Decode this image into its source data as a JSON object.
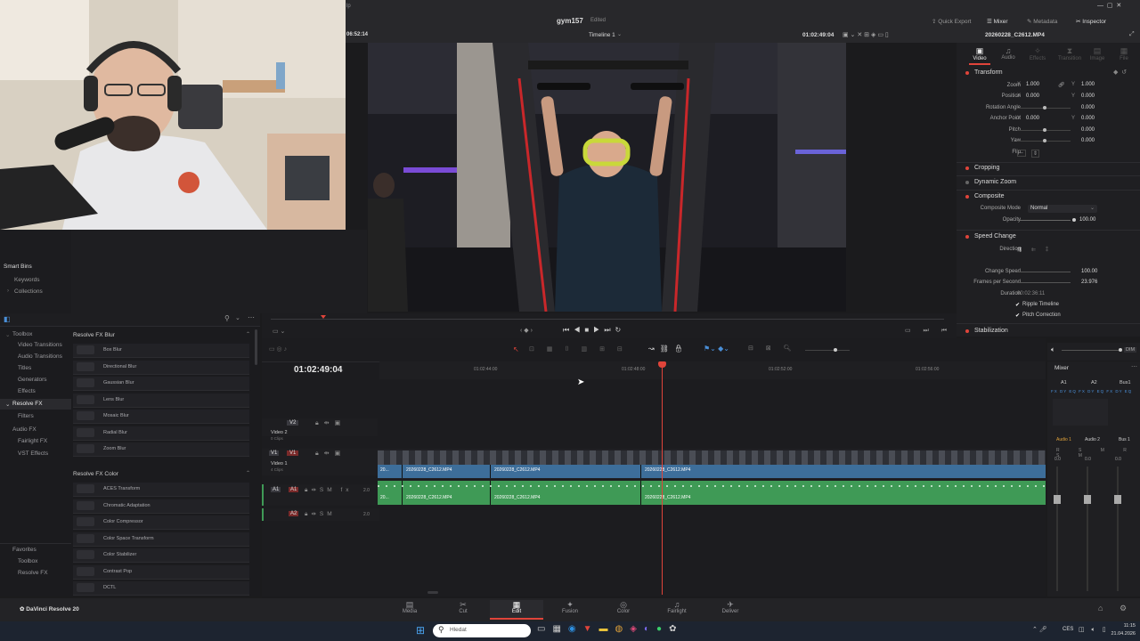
{
  "topbar": {
    "project_name": "gym157",
    "edited_status": "Edited",
    "left_timecode": "06:52:14",
    "timeline_name": "Timeline 1",
    "viewer_timecode": "01:02:49:04",
    "menu_fragment": "lp",
    "buttons": {
      "quick_export": "Quick Export",
      "mixer": "Mixer",
      "metadata": "Metadata",
      "inspector": "Inspector"
    }
  },
  "inspector": {
    "clip_name": "20260228_C2612.MP4",
    "tabs": [
      "Video",
      "Audio",
      "Effects",
      "Transition",
      "Image",
      "File"
    ],
    "transform": {
      "title": "Transform",
      "zoom_label": "Zoom",
      "zoom_x": "1.000",
      "zoom_y": "1.000",
      "position_label": "Position",
      "position_x": "0.000",
      "position_y": "0.000",
      "rotation_label": "Rotation Angle",
      "rotation": "0.000",
      "anchor_label": "Anchor Point",
      "anchor_x": "0.000",
      "anchor_y": "0.000",
      "pitch_label": "Pitch",
      "pitch": "0.000",
      "yaw_label": "Yaw",
      "yaw": "0.000",
      "flip_label": "Flip",
      "axis_x": "X",
      "axis_y": "Y"
    },
    "cropping": "Cropping",
    "dynamic_zoom": "Dynamic Zoom",
    "composite": {
      "title": "Composite",
      "mode_label": "Composite Mode",
      "mode": "Normal",
      "opacity_label": "Opacity",
      "opacity": "100.00"
    },
    "speed_change": {
      "title": "Speed Change",
      "direction_label": "Direction",
      "change_speed_label": "Change Speed",
      "change_speed": "100.00",
      "fps_label": "Frames per Second",
      "fps": "23.976",
      "duration_label": "Duration",
      "duration": "00:02:36:11",
      "ripple_label": "Ripple Timeline",
      "pitch_corr_label": "Pitch Correction"
    },
    "stabilization": "Stabilization"
  },
  "bins": {
    "smart_bins": "Smart Bins",
    "keywords": "Keywords",
    "collections": "Collections"
  },
  "effects_tree": {
    "toolbox": "Toolbox",
    "video_transitions": "Video Transitions",
    "audio_transitions": "Audio Transitions",
    "titles": "Titles",
    "generators": "Generators",
    "effects": "Effects",
    "resolve_fx": "Resolve FX",
    "filters": "Filters",
    "audio_fx": "Audio FX",
    "fairlight_fx": "Fairlight FX",
    "vst_effects": "VST Effects",
    "favorites": "Favorites",
    "fav_toolbox": "Toolbox",
    "fav_resolve_fx": "Resolve FX"
  },
  "fx_list": {
    "blur_header": "Resolve FX Blur",
    "blur_items": [
      "Box Blur",
      "Directional Blur",
      "Gaussian Blur",
      "Lens Blur",
      "Mosaic Blur",
      "Radial Blur",
      "Zoom Blur"
    ],
    "color_header": "Resolve FX Color",
    "color_items": [
      "ACES Transform",
      "Chromatic Adaptation",
      "Color Compressor",
      "Color Space Transform",
      "Color Stabilizer",
      "Contrast Pop",
      "DCTL"
    ]
  },
  "timeline": {
    "timecode": "01:02:49:04",
    "ruler": [
      "01:02:44:00",
      "01:02:48:00",
      "01:02:52:00",
      "01:02:56:00"
    ],
    "tracks": {
      "v2": {
        "id": "V2",
        "name": "Video 2",
        "clips": "0 Clips"
      },
      "v1": {
        "id": "V1",
        "name": "Video 1",
        "clips": "4 Clips"
      },
      "a1": {
        "id": "A1",
        "level": "2.0"
      },
      "a2": {
        "id": "A2",
        "level": "2.0"
      }
    },
    "clip_label": "20260228_C2612.MP4",
    "clip_short": "20..."
  },
  "mixer": {
    "title": "Mixer",
    "channels": [
      "A1",
      "A2",
      "Bus1"
    ],
    "strips": [
      "Audio 1",
      "Audio 2",
      "Bus 1"
    ],
    "dim": "DIM",
    "levels": [
      "0.0",
      "0.0",
      "0.0"
    ]
  },
  "pages": [
    "Media",
    "Cut",
    "Edit",
    "Fusion",
    "Color",
    "Fairlight",
    "Deliver"
  ],
  "app_name": "DaVinci Resolve 20",
  "taskbar": {
    "search_placeholder": "Hledat",
    "lang": "CES",
    "time": "11:15",
    "date": "21.04.2026"
  },
  "colors": {
    "accent_blue": "#4a8fd8",
    "playhead_red": "#e0443a",
    "video_clip": "#3d6e9a",
    "audio_clip": "#3f9a56"
  }
}
